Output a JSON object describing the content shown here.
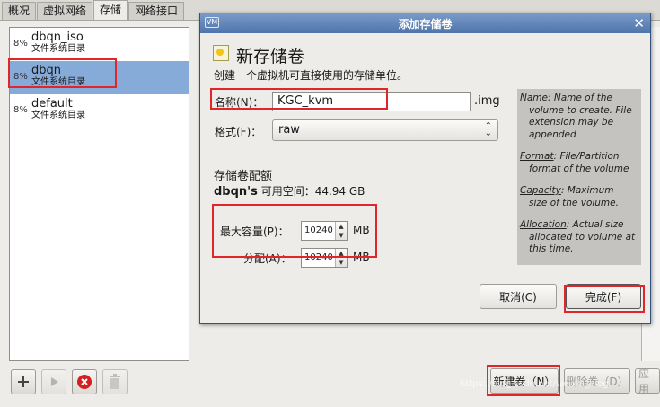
{
  "tabs": [
    "概况",
    "虚拟网络",
    "存储",
    "网络接口"
  ],
  "pools": [
    {
      "usage": "8%",
      "name": "dbqn_iso",
      "type": "文件系统目录"
    },
    {
      "usage": "8%",
      "name": "dbqn",
      "type": "文件系统目录"
    },
    {
      "usage": "8%",
      "name": "default",
      "type": "文件系统目录"
    }
  ],
  "toolbar": {
    "add_icon": "plus-icon",
    "start_icon": "play-icon",
    "stop_icon": "stop-icon",
    "delete_icon": "trash-icon"
  },
  "bottom_buttons": {
    "new_volume": "新建卷（N）",
    "delete_volume": "删除卷（D）",
    "apply": "应用"
  },
  "dialog": {
    "window_title": "添加存储卷",
    "header_title": "新存储卷",
    "header_subtitle": "创建一个虚拟机可直接使用的存储单位。",
    "name_label": "名称(N)：",
    "name_value": "KGC_kvm",
    "name_suffix": ".img",
    "format_label": "格式(F)：",
    "format_value": "raw",
    "quota_title": "存储卷配额",
    "pool_name": "dbqn's",
    "available_label": " 可用空间：",
    "available_value": "44.94 GB",
    "capacity_label": "最大容量(P)：",
    "capacity_value": "10240",
    "capacity_unit": "MB",
    "allocation_label": "分配(A)：",
    "allocation_value": "10240",
    "allocation_unit": "MB",
    "help": [
      {
        "key": "Name",
        "text": ": Name of the",
        "rest": "volume to create. File extension may be appended"
      },
      {
        "key": "Format",
        "text": ": File/Partition",
        "rest": "format of the volume"
      },
      {
        "key": "Capacity",
        "text": ": Maximum",
        "rest": "size of the volume."
      },
      {
        "key": "Allocation",
        "text": ": Actual size",
        "rest": "allocated to volume at this time."
      }
    ],
    "cancel_label": "取消(C)",
    "finish_label": "完成(F)"
  },
  "watermark": "https://blog.csdn.net/weixin_blog"
}
